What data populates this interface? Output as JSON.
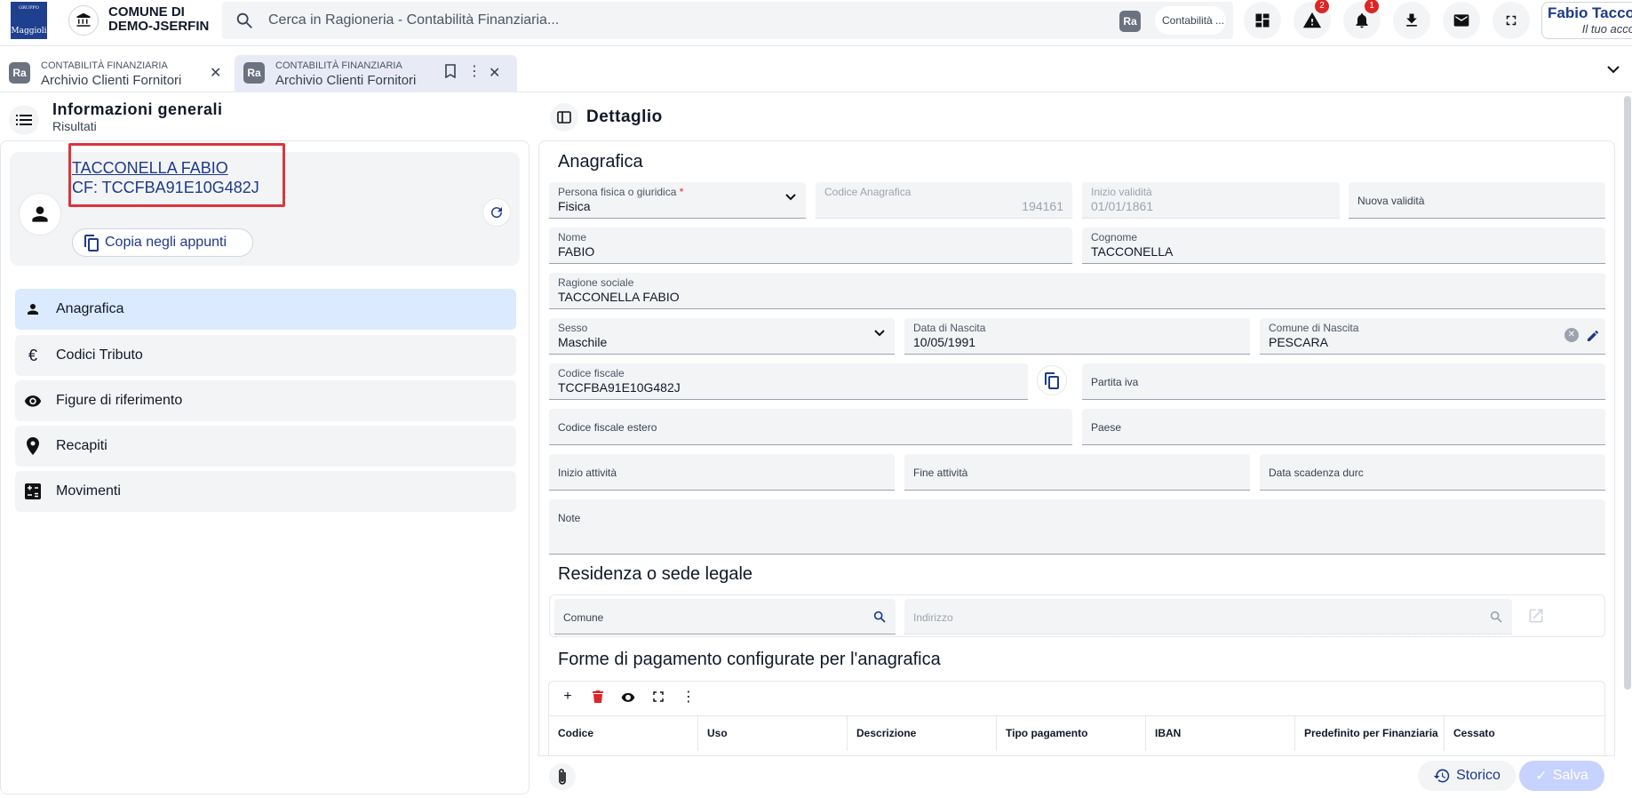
{
  "header": {
    "logo_label": "Maggioli",
    "logo_group": "GRUPPO",
    "municipality": "COMUNE DI DEMO-JSERFIN",
    "search_placeholder": "Cerca in Ragioneria - Contabilità Finanziaria...",
    "context_badge": "Ra",
    "context_label": "Contabilità ...",
    "warnings_count": "2",
    "notifications_count": "1",
    "user_name": "Fabio Tacco",
    "user_sub": "Il tuo acco"
  },
  "tabs": [
    {
      "icon": "Ra",
      "module": "CONTABILITÀ FINANZIARIA",
      "title": "Archivio Clienti Fornitori"
    },
    {
      "icon": "Ra",
      "module": "CONTABILITÀ FINANZIARIA",
      "title": "Archivio Clienti Fornitori"
    }
  ],
  "left": {
    "title": "Informazioni generali",
    "subtitle": "Risultati",
    "card_name": "TACCONELLA FABIO",
    "card_cf": "CF: TCCFBA91E10G482J",
    "copy_label": "Copia negli appunti",
    "nav": [
      {
        "label": "Anagrafica",
        "icon": "person-icon"
      },
      {
        "label": "Codici Tributo",
        "icon": "euro-icon"
      },
      {
        "label": "Figure di riferimento",
        "icon": "eye-icon"
      },
      {
        "label": "Recapiti",
        "icon": "location-pin-icon"
      },
      {
        "label": "Movimenti",
        "icon": "calculator-icon"
      }
    ]
  },
  "right": {
    "title": "Dettaglio",
    "section_anagrafica": "Anagrafica",
    "fields": {
      "persona": {
        "label": "Persona fisica o giuridica",
        "value": "Fisica"
      },
      "codice_anagrafica": {
        "label": "Codice Anagrafica",
        "value": "194161"
      },
      "inizio_validita": {
        "label": "Inizio validità",
        "value": "01/01/1861"
      },
      "nuova_validita": {
        "label": "Nuova validità"
      },
      "nome": {
        "label": "Nome",
        "value": "FABIO"
      },
      "cognome": {
        "label": "Cognome",
        "value": "TACCONELLA"
      },
      "ragione_sociale": {
        "label": "Ragione sociale",
        "value": "TACCONELLA FABIO"
      },
      "sesso": {
        "label": "Sesso",
        "value": "Maschile"
      },
      "data_nascita": {
        "label": "Data di Nascita",
        "value": "10/05/1991"
      },
      "comune_nascita": {
        "label": "Comune di Nascita",
        "value": "PESCARA"
      },
      "codice_fiscale": {
        "label": "Codice fiscale",
        "value": "TCCFBA91E10G482J"
      },
      "partita_iva": {
        "label": "Partita iva"
      },
      "cf_estero": {
        "label": "Codice fiscale estero"
      },
      "paese": {
        "label": "Paese"
      },
      "inizio_attivita": {
        "label": "Inizio attività"
      },
      "fine_attivita": {
        "label": "Fine attività"
      },
      "scadenza_durc": {
        "label": "Data scadenza durc"
      },
      "note": {
        "label": "Note"
      }
    },
    "section_residenza": "Residenza o sede legale",
    "comune_label": "Comune",
    "indirizzo_label": "Indirizzo",
    "section_pagamento": "Forme di pagamento configurate per l'anagrafica",
    "pay_columns": [
      "Codice",
      "Uso",
      "Descrizione",
      "Tipo pagamento",
      "IBAN",
      "Predefinito per Finanziaria",
      "Cessato"
    ]
  },
  "footer": {
    "storico_label": "Storico",
    "salva_label": "Salva"
  }
}
